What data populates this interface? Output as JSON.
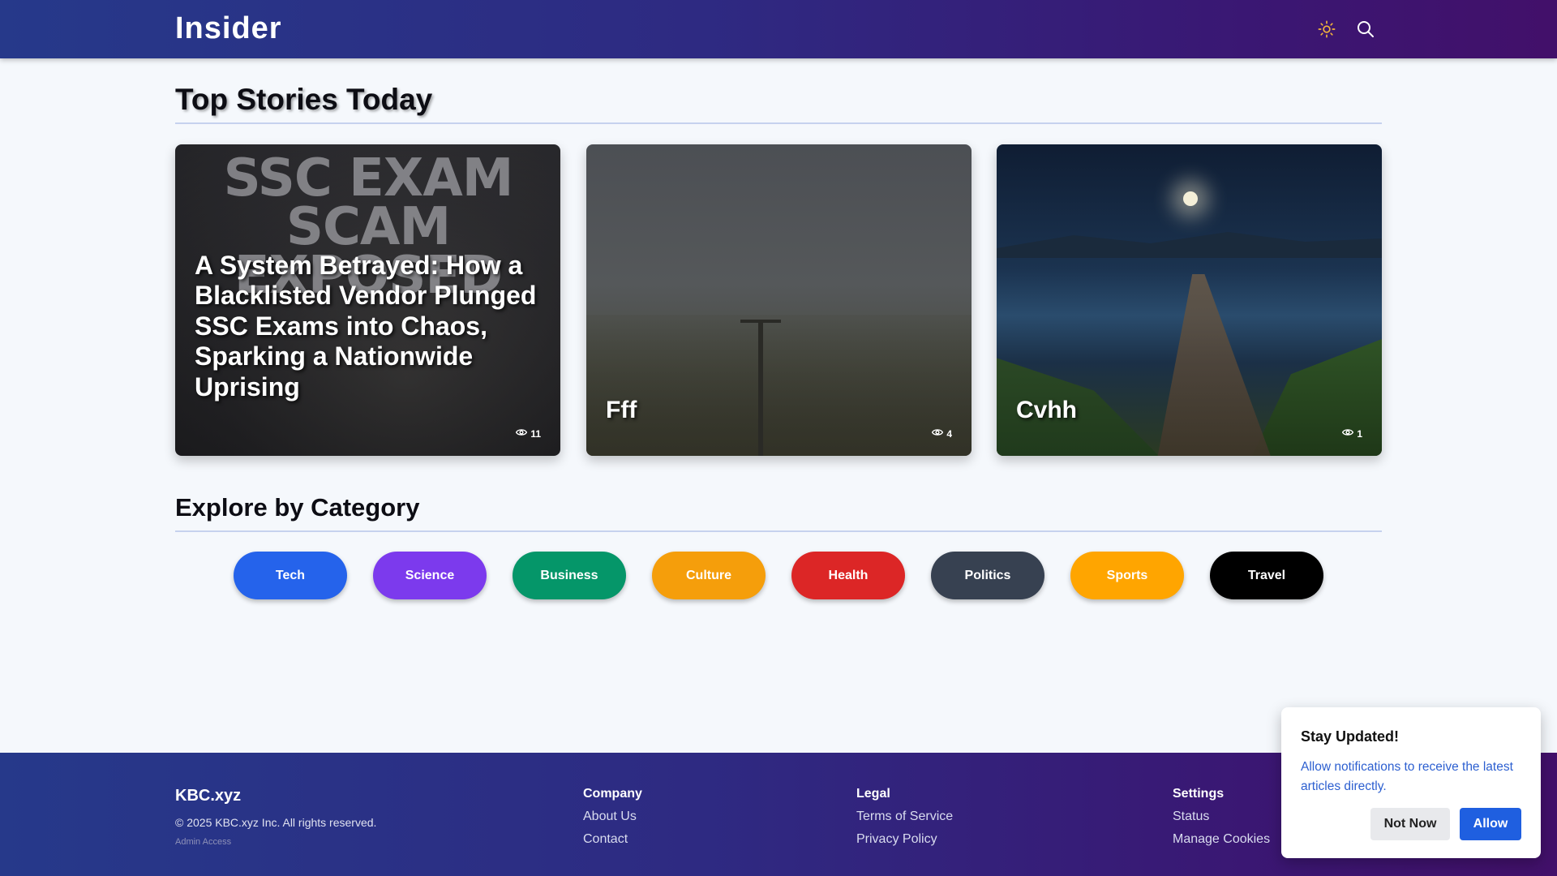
{
  "header": {
    "logo": "Insider",
    "icons": [
      "sun-icon",
      "search-icon"
    ],
    "gradient": [
      "#26398a",
      "#42106a"
    ]
  },
  "top_stories": {
    "title": "Top Stories Today",
    "cards": [
      {
        "overlay_text": "SSC EXAM SCAM EXPOSED",
        "title": "A System Betrayed: How a Blacklisted Vendor Plunged SSC Exams into Chaos, Sparking a Nationwide Uprising",
        "views": "11"
      },
      {
        "title": "Fff",
        "views": "4"
      },
      {
        "title": "Cvhh",
        "views": "1"
      }
    ]
  },
  "categories": {
    "title": "Explore by Category",
    "items": [
      {
        "label": "Tech",
        "color": "#2563eb"
      },
      {
        "label": "Science",
        "color": "#7c3aed"
      },
      {
        "label": "Business",
        "color": "#059669"
      },
      {
        "label": "Culture",
        "color": "#f59e0b"
      },
      {
        "label": "Health",
        "color": "#dc2626"
      },
      {
        "label": "Politics",
        "color": "#374151"
      },
      {
        "label": "Sports",
        "color": "#ffa500"
      },
      {
        "label": "Travel",
        "color": "#000000"
      }
    ]
  },
  "footer": {
    "brand": "KBC.xyz",
    "copyright": "© 2025 KBC.xyz Inc. All rights reserved.",
    "admin": "Admin Access",
    "columns": [
      {
        "heading": "Company",
        "links": [
          "About Us",
          "Contact"
        ]
      },
      {
        "heading": "Legal",
        "links": [
          "Terms of Service",
          "Privacy Policy"
        ]
      },
      {
        "heading": "Settings",
        "links": [
          "Status",
          "Manage Cookies"
        ]
      }
    ]
  },
  "notification": {
    "title": "Stay Updated!",
    "message": "Allow notifications to receive the latest articles directly.",
    "not_now": "Not Now",
    "allow": "Allow"
  }
}
